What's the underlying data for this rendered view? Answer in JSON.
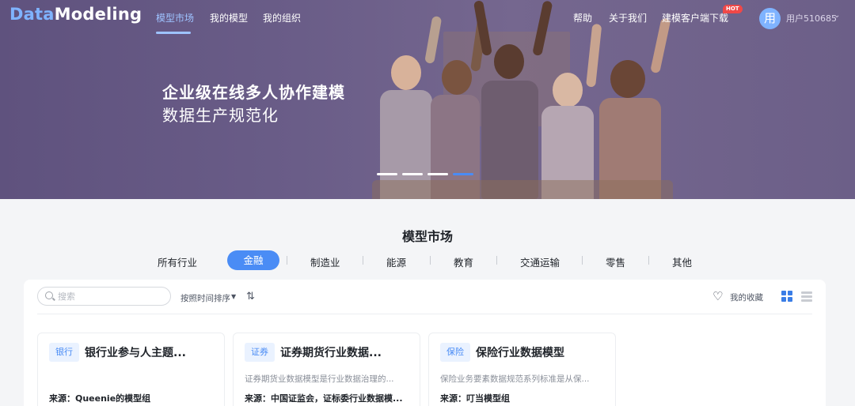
{
  "brand": {
    "part1": "Data",
    "part2": "Modeling"
  },
  "nav": {
    "left": [
      "模型市场",
      "我的模型",
      "我的组织"
    ],
    "right": [
      "帮助",
      "关于我们",
      "建模客户端下载"
    ],
    "hot_badge": "HOT"
  },
  "user": {
    "avatar_char": "用",
    "name": "用户510685"
  },
  "hero": {
    "title": "企业级在线多人协作建模",
    "subtitle": "数据生产规范化",
    "slides_count": 4,
    "active_slide": 4
  },
  "market": {
    "title": "模型市场",
    "categories": [
      "所有行业",
      "金融",
      "制造业",
      "能源",
      "教育",
      "交通运输",
      "零售",
      "其他"
    ],
    "active_category": "金融"
  },
  "toolbar": {
    "search_placeholder": "搜索",
    "sort_label": "按照时间排序",
    "favorites_label": "我的收藏"
  },
  "cards": [
    {
      "tag": "银行",
      "title": "银行业参与人主题...",
      "desc": "",
      "source": "来源：Queenie的模型组"
    },
    {
      "tag": "证券",
      "title": "证券期货行业数据...",
      "desc": "证券期货业数据模型是行业数据治理的...",
      "source": "来源：中国证监会，证标委行业数据模..."
    },
    {
      "tag": "保险",
      "title": "保险行业数据模型",
      "desc": "保险业务要素数据规范系列标准是从保...",
      "source": "来源：叮当模型组"
    }
  ],
  "colors": {
    "accent": "#4a8cf5",
    "hero_bg": "#6a5d88",
    "hot": "#f04848"
  }
}
